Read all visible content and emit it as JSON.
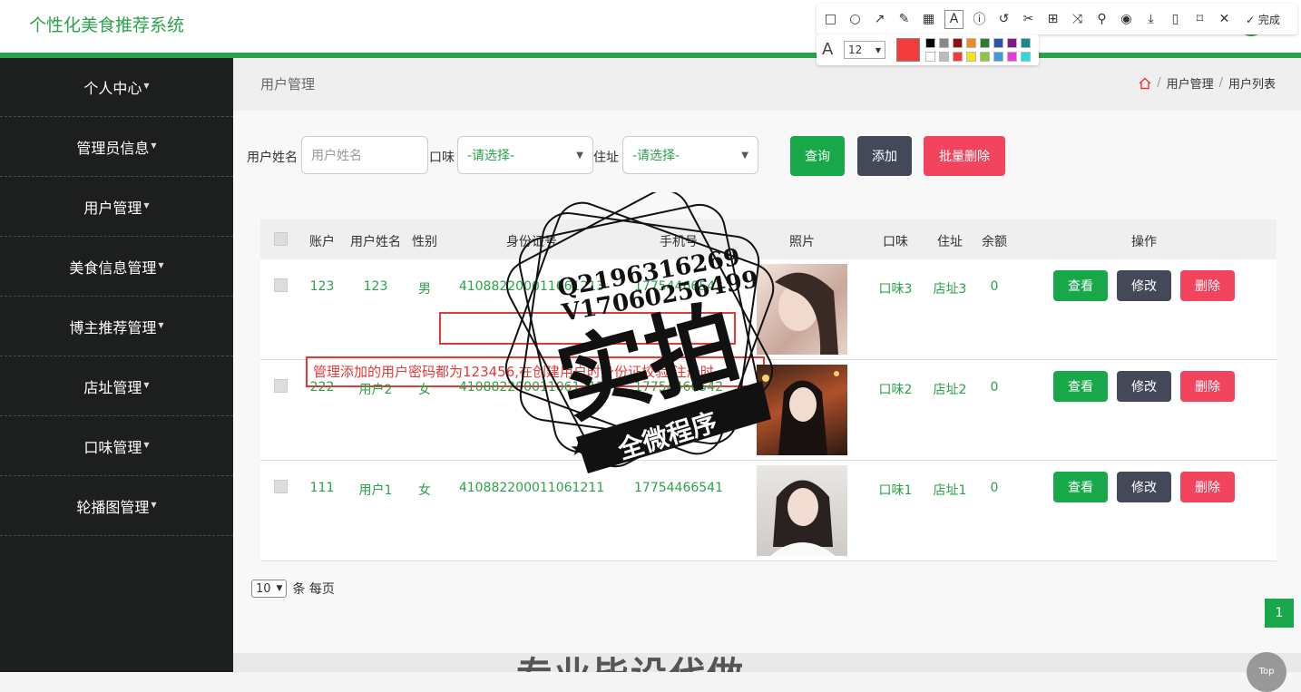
{
  "app": {
    "title": "个性化美食推荐系统"
  },
  "sidebar": {
    "items": [
      {
        "label": "个人中心"
      },
      {
        "label": "管理员信息"
      },
      {
        "label": "用户管理"
      },
      {
        "label": "美食信息管理"
      },
      {
        "label": "博主推荐管理"
      },
      {
        "label": "店址管理"
      },
      {
        "label": "口味管理"
      },
      {
        "label": "轮播图管理"
      }
    ]
  },
  "breadcrumb": {
    "title": "用户管理",
    "level1": "用户管理",
    "level2": "用户列表",
    "sep": "/"
  },
  "search": {
    "name_label": "用户姓名",
    "name_placeholder": "用户姓名",
    "taste_label": "口味",
    "taste_value": "-请选择-",
    "address_label": "住址",
    "address_value": "-请选择-",
    "query_button": "查询",
    "add_button": "添加",
    "batch_delete_button": "批量删除"
  },
  "table": {
    "headers": [
      "账户",
      "用户姓名",
      "性别",
      "身份证号",
      "手机号",
      "照片",
      "口味",
      "住址",
      "余额",
      "操作"
    ],
    "rows": [
      {
        "account": "123",
        "name": "123",
        "gender": "男",
        "id_number": "410882200011061213",
        "phone": "17754466543",
        "taste": "口味3",
        "address": "店址3",
        "balance": "0"
      },
      {
        "account": "222",
        "name": "用户2",
        "gender": "女",
        "id_number": "410882200011061212",
        "phone": "17754466542",
        "taste": "口味2",
        "address": "店址2",
        "balance": "0"
      },
      {
        "account": "111",
        "name": "用户1",
        "gender": "女",
        "id_number": "410882200011061211",
        "phone": "17754466541",
        "taste": "口味1",
        "address": "店址1",
        "balance": "0"
      }
    ],
    "actions": {
      "view": "查看",
      "edit": "修改",
      "delete": "删除"
    },
    "note": "管理添加的用户密码都为123456,在创建用户时身份证校验,注册时"
  },
  "pagination": {
    "page_size": "10",
    "suffix": "条 每页",
    "current_page": "1"
  },
  "footer": {
    "banner": "专业毕设代做",
    "top_button": "Top"
  },
  "watermark": {
    "line1": "Q2196316269",
    "line2": "V17060256499",
    "main": "实拍",
    "sub": "全微程序"
  },
  "annotation_toolbar": {
    "font_size": "12",
    "done_label": "完成",
    "active_color": "#f23b3b"
  },
  "colors": {
    "accent": "#2aa14a",
    "sidebar_bg": "#1d1f1e",
    "danger": "#f2445d",
    "dark_button": "#44495a"
  }
}
